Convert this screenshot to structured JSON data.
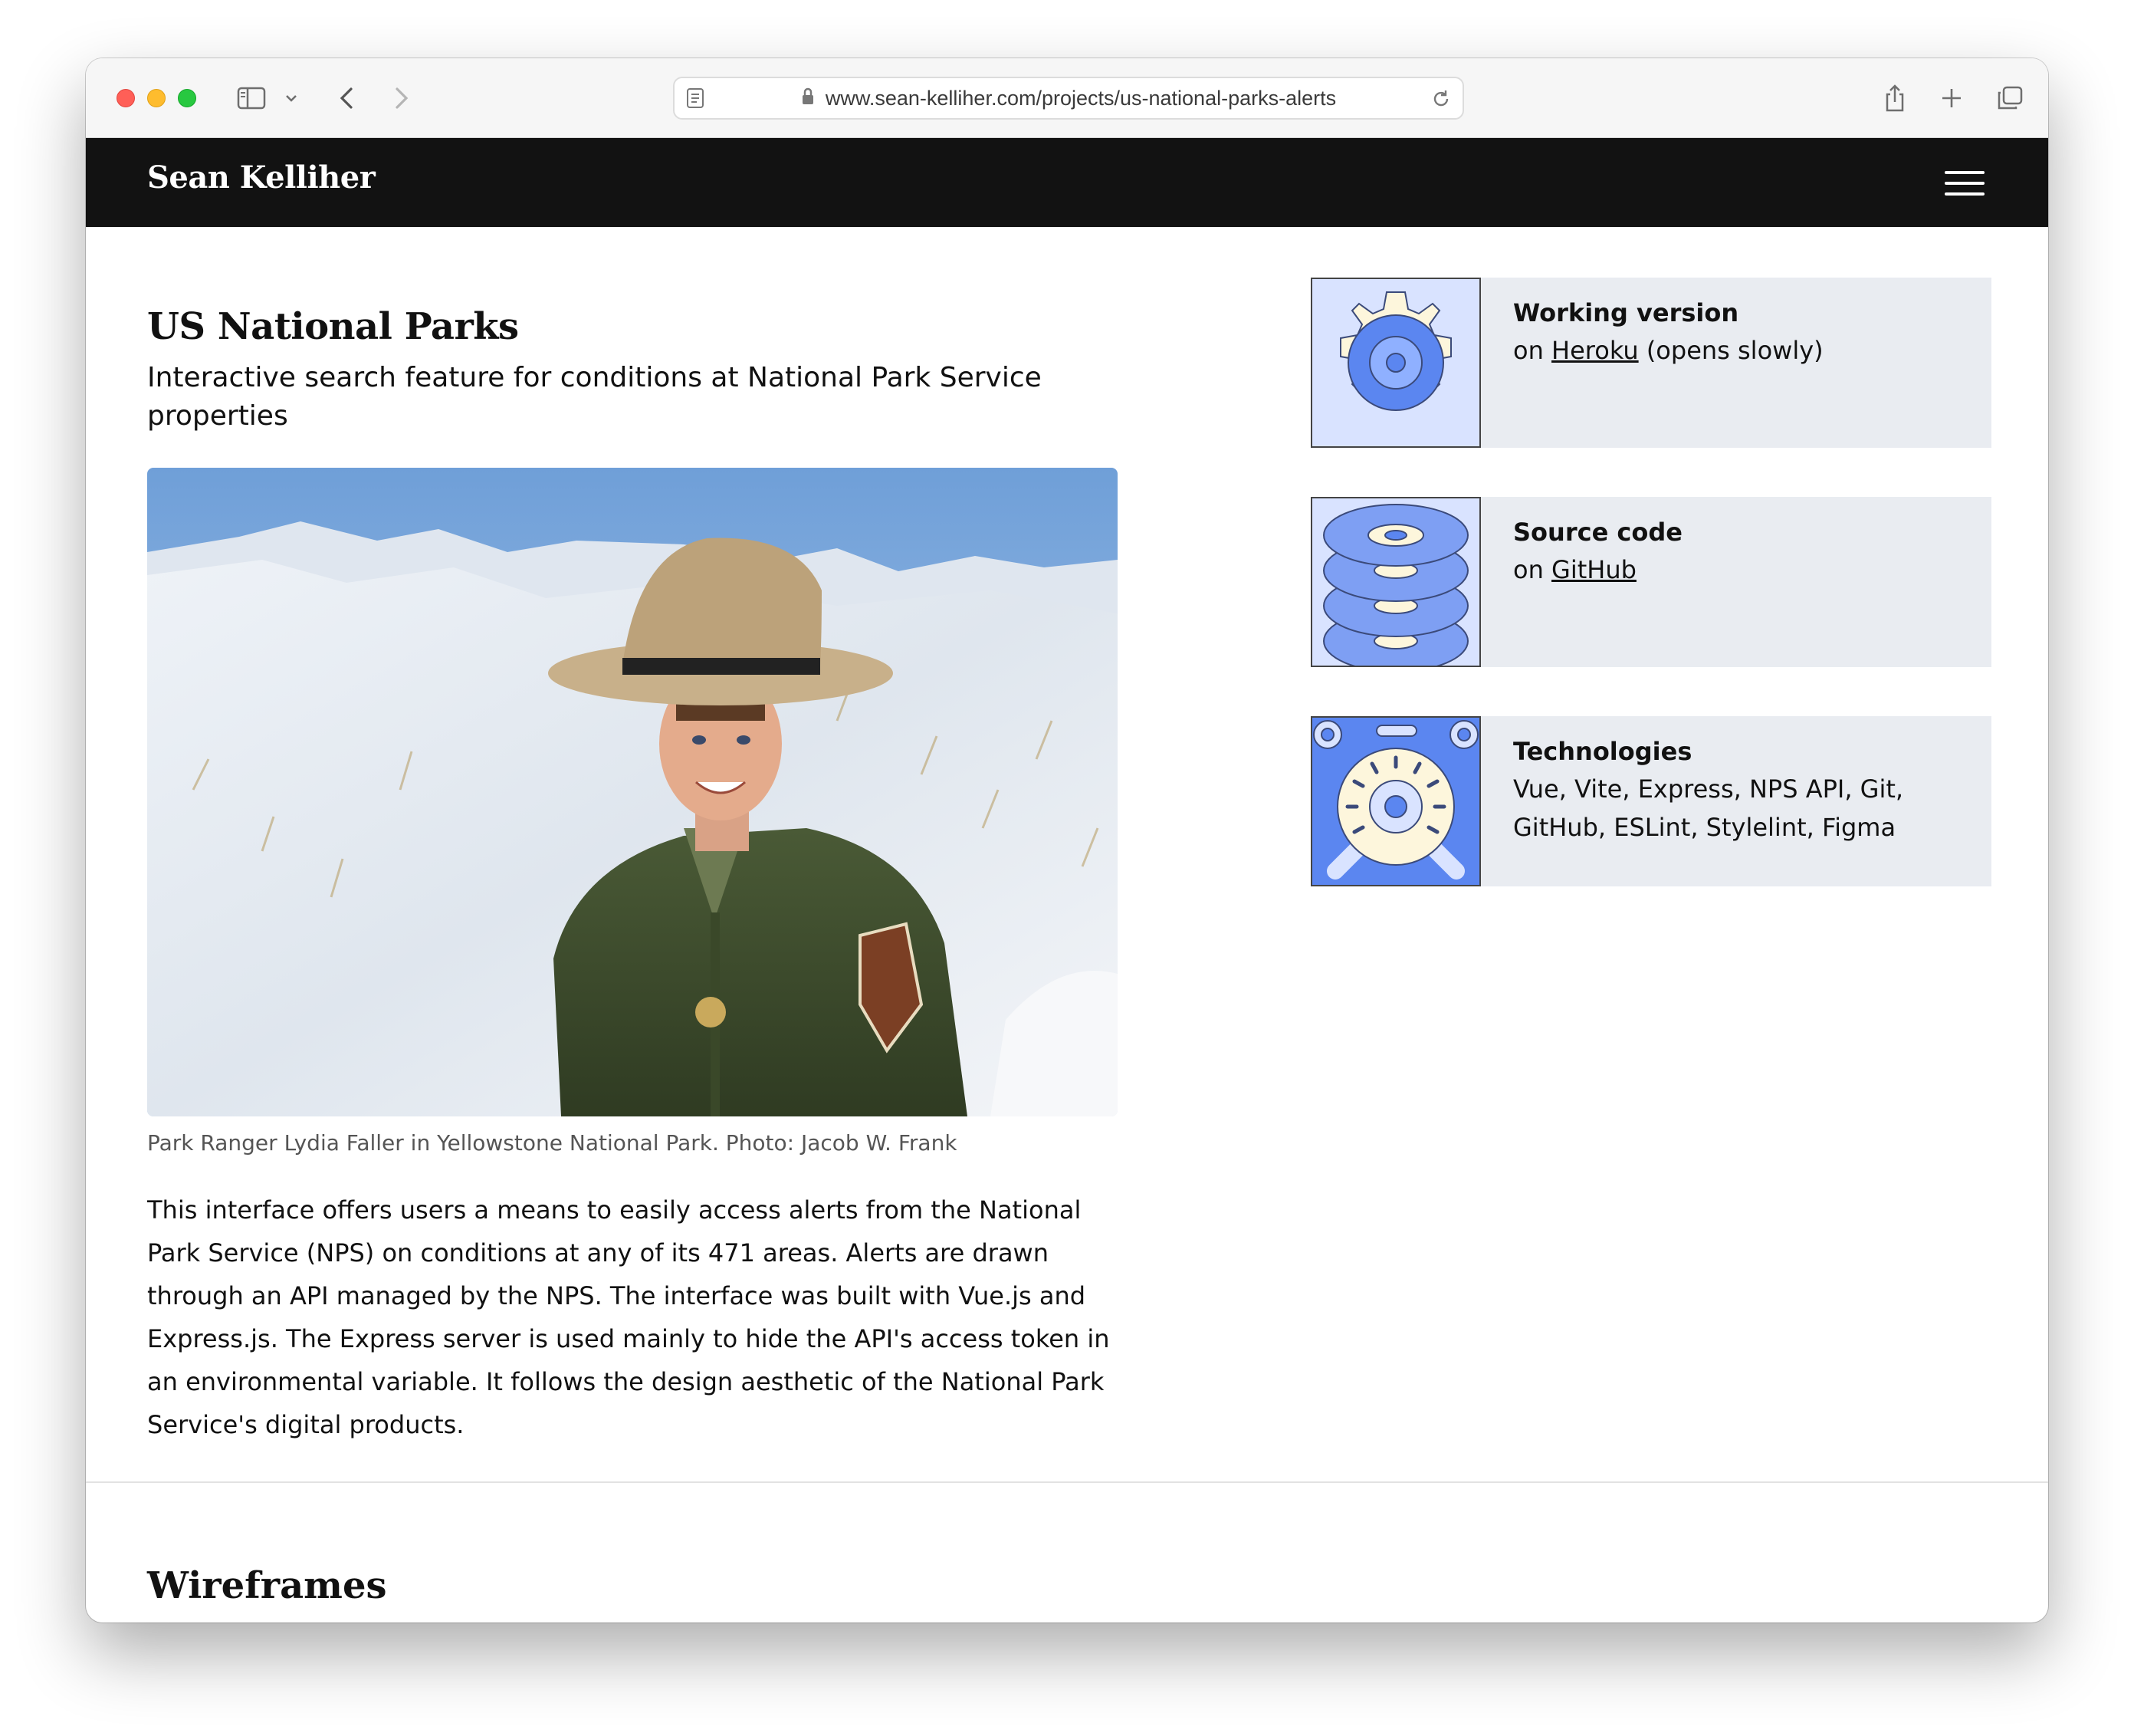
{
  "browser": {
    "url": "www.sean-kelliher.com/projects/us-national-parks-alerts"
  },
  "site": {
    "brand": "Sean Kelliher"
  },
  "page": {
    "title": "US National Parks",
    "subtitle": "Interactive search feature for conditions at National Park Service properties",
    "caption": "Park Ranger Lydia Faller in Yellowstone National Park. Photo: Jacob W. Frank",
    "body": "This interface offers users a means to easily access alerts from the National Park Service (NPS) on conditions at any of its 471 areas. Alerts are drawn through an API managed by the NPS. The interface was built with Vue.js and Express.js. The Express server is used mainly to hide the API's access token in an environmental variable. It follows the design aesthetic of the National Park Service's digital products.",
    "section2_title": "Wireframes"
  },
  "cards": [
    {
      "title": "Working version",
      "prefix": "on ",
      "link": "Heroku",
      "suffix": " (opens slowly)",
      "icon": "gear-icon"
    },
    {
      "title": "Source code",
      "prefix": "on ",
      "link": "GitHub",
      "suffix": "",
      "icon": "stacked-disks-icon"
    },
    {
      "title": "Technologies",
      "text": "Vue, Vite, Express, NPS API, Git, GitHub, ESLint, Stylelint, Figma",
      "icon": "dial-machine-icon"
    }
  ],
  "colors": {
    "nav_bg": "#121212",
    "card_bg": "#e9ecf1",
    "icon_blue": "#5b86f0",
    "icon_light": "#d9e3ff",
    "icon_cream": "#fdf6dc"
  }
}
